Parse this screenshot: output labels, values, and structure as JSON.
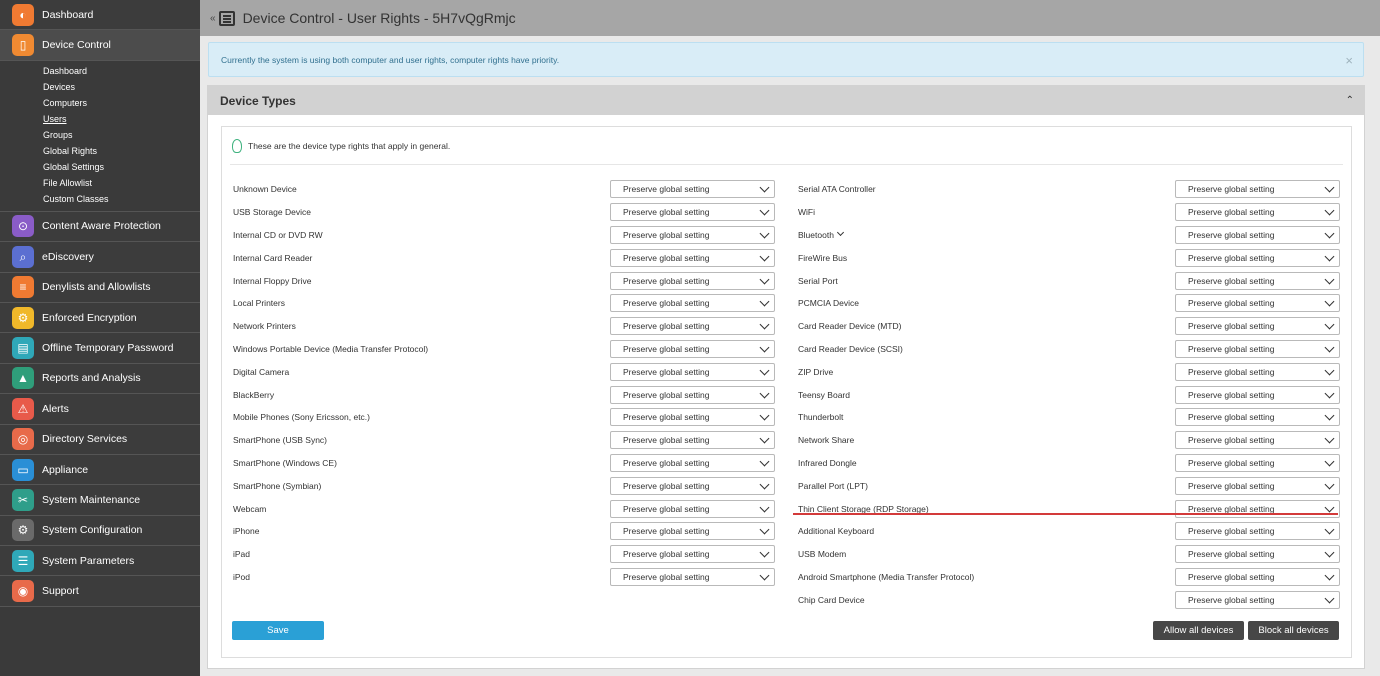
{
  "sidebar": {
    "items": [
      {
        "label": "Dashboard",
        "icon": "dashboard-icon",
        "color": "#f07a32",
        "glyph": "◐"
      },
      {
        "label": "Device Control",
        "icon": "device-control-icon",
        "color": "#f08a32",
        "glyph": "▯",
        "active": true
      },
      {
        "label": "Content Aware Protection",
        "icon": "content-aware-icon",
        "color": "#8a5cc7",
        "glyph": "⊙"
      },
      {
        "label": "eDiscovery",
        "icon": "ediscovery-icon",
        "color": "#5b6fd1",
        "glyph": "⌕"
      },
      {
        "label": "Denylists and Allowlists",
        "icon": "lists-icon",
        "color": "#f07a32",
        "glyph": "≡"
      },
      {
        "label": "Enforced Encryption",
        "icon": "encryption-icon",
        "color": "#f0b82a",
        "glyph": "⚙"
      },
      {
        "label": "Offline Temporary Password",
        "icon": "password-icon",
        "color": "#2fa8b8",
        "glyph": "▤"
      },
      {
        "label": "Reports and Analysis",
        "icon": "reports-icon",
        "color": "#2f9e7a",
        "glyph": "▲"
      },
      {
        "label": "Alerts",
        "icon": "alerts-icon",
        "color": "#e85a4a",
        "glyph": "⚠"
      },
      {
        "label": "Directory Services",
        "icon": "directory-icon",
        "color": "#e86a4a",
        "glyph": "◎"
      },
      {
        "label": "Appliance",
        "icon": "appliance-icon",
        "color": "#2a8fd6",
        "glyph": "▭"
      },
      {
        "label": "System Maintenance",
        "icon": "maintenance-icon",
        "color": "#2f9e8a",
        "glyph": "✂"
      },
      {
        "label": "System Configuration",
        "icon": "configuration-icon",
        "color": "#6a6a6a",
        "glyph": "⚙"
      },
      {
        "label": "System Parameters",
        "icon": "parameters-icon",
        "color": "#2fa8b8",
        "glyph": "☰"
      },
      {
        "label": "Support",
        "icon": "support-icon",
        "color": "#e86a4a",
        "glyph": "◉"
      }
    ],
    "device_control_sub": [
      {
        "label": "Dashboard"
      },
      {
        "label": "Devices"
      },
      {
        "label": "Computers"
      },
      {
        "label": "Users",
        "active": true
      },
      {
        "label": "Groups"
      },
      {
        "label": "Global Rights"
      },
      {
        "label": "Global Settings"
      },
      {
        "label": "File Allowlist"
      },
      {
        "label": "Custom Classes"
      }
    ]
  },
  "header": {
    "toggle": "«",
    "title": "Device Control - User Rights - 5H7vQgRmjc"
  },
  "banner": {
    "text": "Currently the system is using both computer and user rights, computer rights have priority.",
    "close": "×"
  },
  "panel": {
    "title": "Device Types",
    "hint": "These are the device type rights that apply in general."
  },
  "select_value": "Preserve global setting",
  "left_devices": [
    "Unknown Device",
    "USB Storage Device",
    "Internal CD or DVD RW",
    "Internal Card Reader",
    "Internal Floppy Drive",
    "Local Printers",
    "Network Printers",
    "Windows Portable Device (Media Transfer Protocol)",
    "Digital Camera",
    "BlackBerry",
    "Mobile Phones (Sony Ericsson, etc.)",
    "SmartPhone (USB Sync)",
    "SmartPhone (Windows CE)",
    "SmartPhone (Symbian)",
    "Webcam",
    "iPhone",
    "iPad",
    "iPod"
  ],
  "right_devices": [
    "Serial ATA Controller",
    "WiFi",
    "Bluetooth",
    "FireWire Bus",
    "Serial Port",
    "PCMCIA Device",
    "Card Reader Device (MTD)",
    "Card Reader Device (SCSI)",
    "ZIP Drive",
    "Teensy Board",
    "Thunderbolt",
    "Network Share",
    "Infrared Dongle",
    "Parallel Port (LPT)",
    "Thin Client Storage (RDP Storage)",
    "Additional Keyboard",
    "USB Modem",
    "Android Smartphone (Media Transfer Protocol)",
    "Chip Card Device"
  ],
  "buttons": {
    "save": "Save",
    "allow_all": "Allow all devices",
    "block_all": "Block all devices"
  }
}
